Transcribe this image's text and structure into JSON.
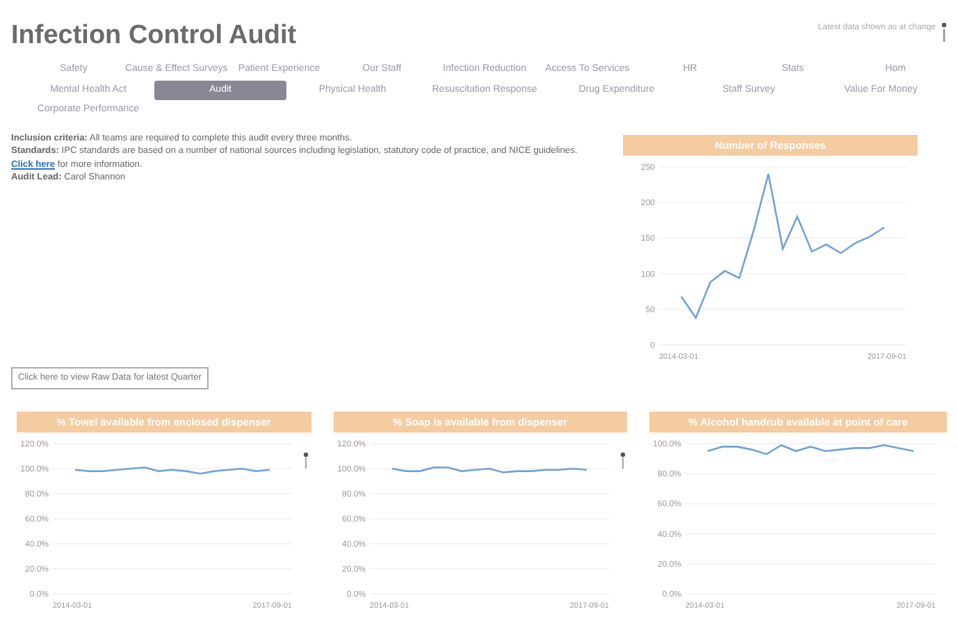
{
  "title": "Infection Control Audit",
  "top_note": "Latest data shown as at change",
  "tab_rows": [
    [
      {
        "label": "Safety",
        "selected": false
      },
      {
        "label": "Cause & Effect Surveys",
        "selected": false
      },
      {
        "label": "Patient Experience",
        "selected": false
      },
      {
        "label": "Our Staff",
        "selected": false
      },
      {
        "label": "Infection Reduction",
        "selected": false
      },
      {
        "label": "Access To Services",
        "selected": false
      },
      {
        "label": "HR",
        "selected": false
      },
      {
        "label": "Stats",
        "selected": false
      },
      {
        "label": "Hom",
        "selected": false
      }
    ],
    [
      {
        "label": "Mental Health Act",
        "selected": false
      },
      {
        "label": "Audit",
        "selected": true
      },
      {
        "label": "Physical Health",
        "selected": false
      },
      {
        "label": "Resuscitation Response",
        "selected": false
      },
      {
        "label": "Drug Expenditure",
        "selected": false
      },
      {
        "label": "Staff Survey",
        "selected": false
      },
      {
        "label": "Value For Money",
        "selected": false
      }
    ],
    [
      {
        "label": "Corporate Performance",
        "selected": false
      }
    ]
  ],
  "info": [
    {
      "label": "Inclusion criteria:",
      "text": "All teams are required to complete this audit every three months."
    },
    {
      "label": "Standards:",
      "text": "IPC standards are based on a number of national sources including legislation, statutory code of practice, and NICE guidelines.",
      "link": "Click here",
      "after": "for more information."
    },
    {
      "label": "Audit Lead:",
      "text": "Carol Shannon"
    }
  ],
  "raw_data_button": "Click here to view Raw Data for latest Quarter",
  "responses_chart": {
    "chart_data": {
      "type": "line",
      "title": "Number of Responses",
      "yticks": [
        0,
        50,
        100,
        150,
        200,
        250
      ],
      "ylim": [
        0,
        250
      ],
      "grid": true,
      "series": [
        {
          "color": "#6fa3d8",
          "values": [
            68,
            38,
            88,
            104,
            94,
            161,
            240,
            135,
            180,
            131,
            141,
            129,
            143,
            152,
            165
          ]
        }
      ]
    },
    "date_labels": [
      "2014-03-01",
      "2017-09-01"
    ]
  },
  "audit_charts": [
    {
      "chart_data": {
        "type": "line",
        "title": "% Towel available from enclosed dispenser",
        "yticks": [
          {
            "value": 0,
            "label": "0.0%"
          },
          {
            "value": 20,
            "label": "20.0%"
          },
          {
            "value": 40,
            "label": "40.0%"
          },
          {
            "value": 60,
            "label": "60.0%"
          },
          {
            "value": 80,
            "label": "80.0%"
          },
          {
            "value": 100,
            "label": "100.0%"
          },
          {
            "value": 120,
            "label": "120.0%"
          }
        ],
        "ylim": [
          0,
          120
        ],
        "grid": true,
        "series": [
          {
            "color": "#6fa3d8",
            "values": [
              99,
              98,
              98,
              99,
              100,
              101,
              98,
              99,
              98,
              96,
              98,
              99,
              100,
              98,
              99
            ]
          }
        ]
      },
      "date_labels": [
        "2014-03-01",
        "2017-09-01"
      ]
    },
    {
      "chart_data": {
        "type": "line",
        "title": "% Soap is available from dispenser",
        "yticks": [
          {
            "value": 0,
            "label": "0.0%"
          },
          {
            "value": 20,
            "label": "20.0%"
          },
          {
            "value": 40,
            "label": "40.0%"
          },
          {
            "value": 60,
            "label": "60.0%"
          },
          {
            "value": 80,
            "label": "80.0%"
          },
          {
            "value": 100,
            "label": "100.0%"
          },
          {
            "value": 120,
            "label": "120.0%"
          }
        ],
        "ylim": [
          0,
          120
        ],
        "grid": true,
        "series": [
          {
            "color": "#6fa3d8",
            "values": [
              100,
              98,
              98,
              101,
              101,
              98,
              99,
              100,
              97,
              98,
              98,
              99,
              99,
              100,
              99
            ]
          }
        ]
      },
      "date_labels": [
        "2014-03-01",
        "2017-09-01"
      ]
    },
    {
      "chart_data": {
        "type": "line",
        "title": "% Alcohol handrub available at point of care",
        "yticks": [
          {
            "value": 0,
            "label": "0.0%"
          },
          {
            "value": 20,
            "label": "20.0%"
          },
          {
            "value": 40,
            "label": "40.0%"
          },
          {
            "value": 60,
            "label": "60.0%"
          },
          {
            "value": 80,
            "label": "80.0%"
          },
          {
            "value": 100,
            "label": "100.0%"
          }
        ],
        "ylim": [
          0,
          100
        ],
        "grid": true,
        "series": [
          {
            "color": "#6fa3d8",
            "values": [
              95,
              98,
              98,
              96,
              93,
              99,
              95,
              98,
              95,
              96,
              97,
              97,
              99,
              97,
              95
            ]
          }
        ]
      },
      "date_labels": [
        "2014-03-01",
        "2017-09-01"
      ]
    }
  ]
}
